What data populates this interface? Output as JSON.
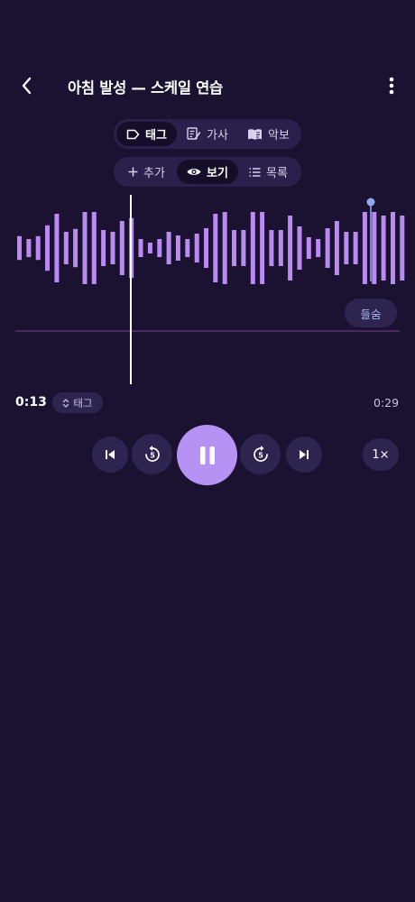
{
  "header": {
    "title": "아침 발성 — 스케일 연습"
  },
  "mode_tabs": [
    {
      "label": "태그",
      "icon": "tag-icon",
      "active": true
    },
    {
      "label": "가사",
      "icon": "lyrics-icon",
      "active": false
    },
    {
      "label": "악보",
      "icon": "book-icon",
      "active": false
    }
  ],
  "view_tabs": [
    {
      "label": "추가",
      "icon": "plus-icon",
      "active": false
    },
    {
      "label": "보기",
      "icon": "eye-icon",
      "active": true
    },
    {
      "label": "목록",
      "icon": "list-icon",
      "active": false
    }
  ],
  "waveform": {
    "bar_color": "#b98af0",
    "playhead_color": "#ffffff",
    "marker_color": "#8fa8ee",
    "baseline_color": "#4a2a5c",
    "levels": [
      0.33,
      0.25,
      0.33,
      0.63,
      0.95,
      0.45,
      0.53,
      1.0,
      1.0,
      0.5,
      0.45,
      0.75,
      0.83,
      0.25,
      0.15,
      0.25,
      0.45,
      0.35,
      0.25,
      0.4,
      0.55,
      0.95,
      1.0,
      0.5,
      0.5,
      1.0,
      1.0,
      0.5,
      0.5,
      0.9,
      0.6,
      0.3,
      0.25,
      0.55,
      0.75,
      0.45,
      0.45,
      1.0,
      1.0,
      0.9,
      1.0,
      0.9
    ]
  },
  "listen_button": "들숨",
  "playback": {
    "current_time": "0:13",
    "total_time": "0:29",
    "tag_chip": "태그",
    "speed": "1×",
    "skip_seconds": "5"
  },
  "colors": {
    "background": "#1b1131",
    "accent": "#b792f5",
    "chip": "#2e2450"
  }
}
